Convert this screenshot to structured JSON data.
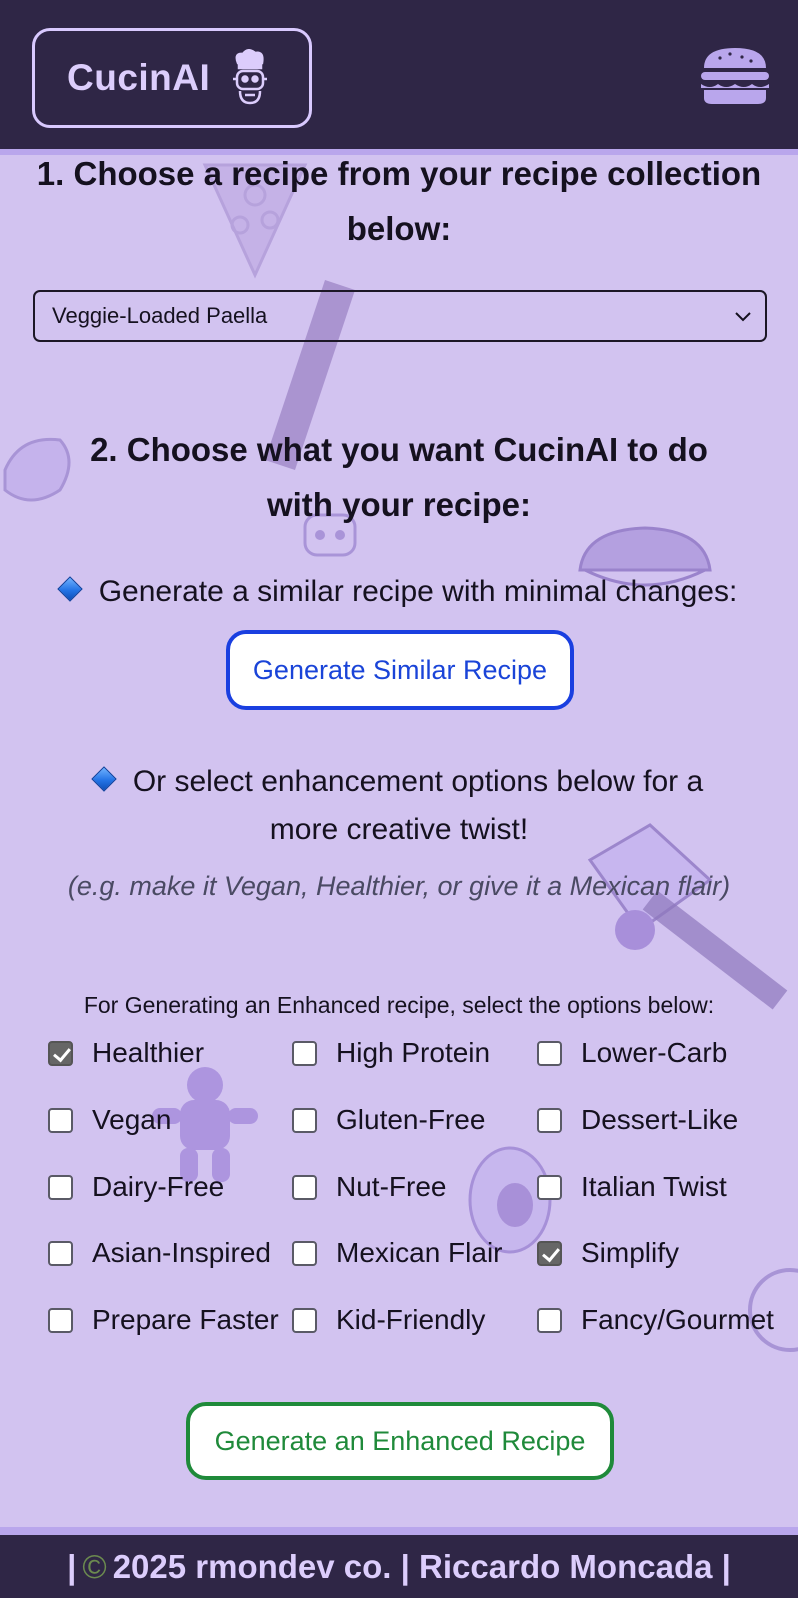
{
  "header": {
    "brand": "CucinAI",
    "logo_icon": "chef-robot-icon",
    "menu_icon": "hamburger-menu-icon"
  },
  "step1": {
    "heading": "1. Choose a recipe from your recipe collection below:",
    "selected_recipe": "Veggie-Loaded Paella"
  },
  "step2": {
    "heading": "2. Choose what you want CucinAI to do with your recipe:",
    "similar_prompt": "Generate a similar recipe with minimal changes:",
    "similar_button": "Generate Similar Recipe",
    "enhance_prompt": "Or select enhancement options below for a more creative twist!",
    "enhance_hint": "(e.g. make it Vegan, Healthier, or give it a Mexican flair)",
    "options_label": "For Generating an Enhanced recipe, select the options below:",
    "options": [
      {
        "label": "Healthier",
        "checked": true
      },
      {
        "label": "High Protein",
        "checked": false
      },
      {
        "label": "Lower-Carb",
        "checked": false
      },
      {
        "label": "Vegan",
        "checked": false
      },
      {
        "label": "Gluten-Free",
        "checked": false
      },
      {
        "label": "Dessert-Like",
        "checked": false
      },
      {
        "label": "Dairy-Free",
        "checked": false
      },
      {
        "label": "Nut-Free",
        "checked": false
      },
      {
        "label": "Italian Twist",
        "checked": false
      },
      {
        "label": "Asian-Inspired",
        "checked": false
      },
      {
        "label": "Mexican Flair",
        "checked": false
      },
      {
        "label": "Simplify",
        "checked": true
      },
      {
        "label": "Prepare Faster",
        "checked": false
      },
      {
        "label": "Kid-Friendly",
        "checked": false
      },
      {
        "label": "Fancy/Gourmet",
        "checked": false
      }
    ],
    "enhanced_button": "Generate an Enhanced Recipe"
  },
  "footer": {
    "lead": "|",
    "copyright_symbol": "©",
    "text": "2025 rmondev co. | Riccardo Moncada |"
  },
  "colors": {
    "background": "#d2c3f0",
    "header": "#2f2646",
    "accent": "#b9a6ec",
    "similar_button": "#1a3fe0",
    "enhanced_button": "#1f8a3a"
  }
}
